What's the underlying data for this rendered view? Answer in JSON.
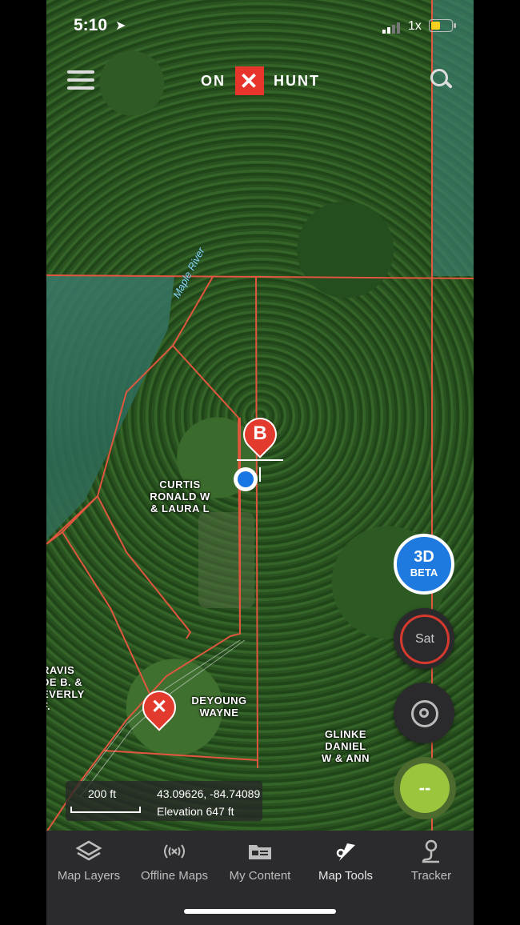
{
  "status_bar": {
    "time": "5:10",
    "zoom_indicator": "1x",
    "battery_color": "#f7d11e",
    "battery_level": 0.5
  },
  "header": {
    "logo_left": "ON",
    "logo_mark": "✕",
    "logo_right": "HUNT",
    "brand_color": "#e8352c"
  },
  "map": {
    "river_label": "Maple River",
    "parcels": [
      {
        "owner": "CURTIS\nRONALD W\n& LAURA L"
      },
      {
        "owner": "DEYOUNG\nWAYNE"
      },
      {
        "owner": "GLINKE\nDANIEL\nW & ANN"
      },
      {
        "owner": "RAVIS\nDE B. &\nEVERLY\nF."
      }
    ],
    "waypoints": [
      {
        "name": "bookmark-pin",
        "glyph": "B"
      },
      {
        "name": "x-marker-pin",
        "glyph": "✕"
      }
    ]
  },
  "controls": {
    "btn_3d_main": "3D",
    "btn_3d_sub": "BETA",
    "sat_label": "Sat",
    "tracker_value": "--"
  },
  "info_panel": {
    "scale": "200 ft",
    "coordinates": "43.09626, -84.74089",
    "elevation": "Elevation 647 ft"
  },
  "tabs": [
    {
      "label": "Map Layers",
      "icon": "layers-icon"
    },
    {
      "label": "Offline Maps",
      "icon": "offline-icon"
    },
    {
      "label": "My Content",
      "icon": "folder-icon"
    },
    {
      "label": "Map Tools",
      "icon": "tools-icon"
    },
    {
      "label": "Tracker",
      "icon": "tracker-icon"
    }
  ]
}
